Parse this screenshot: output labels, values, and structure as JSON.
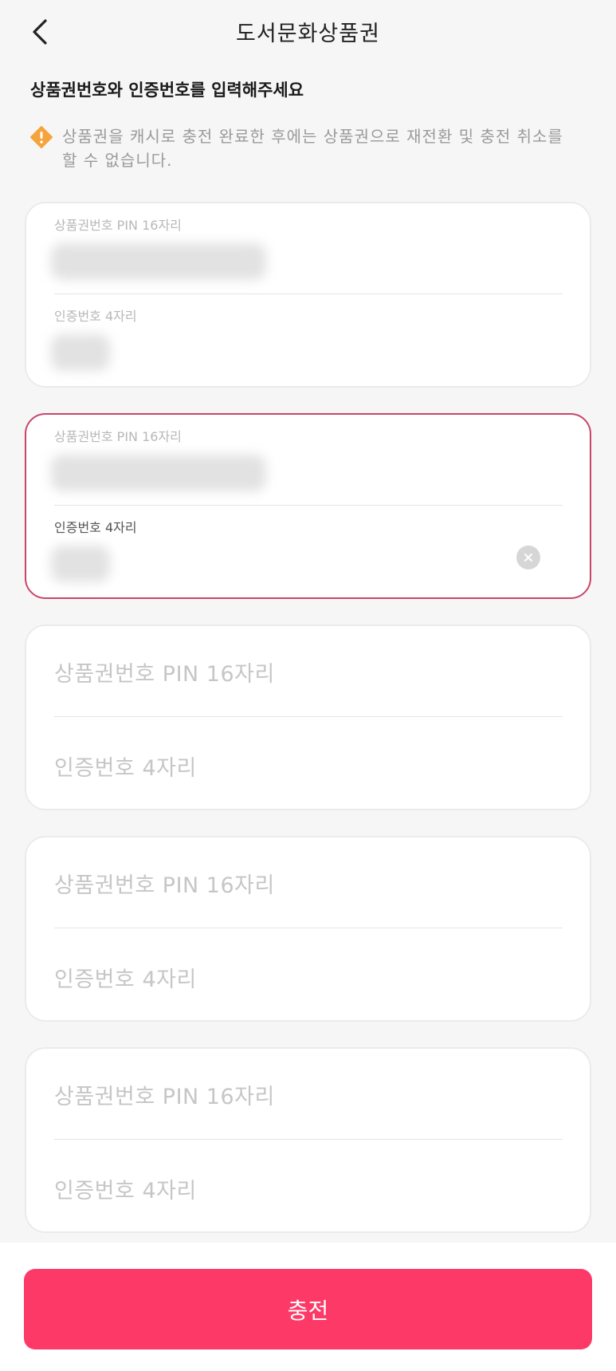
{
  "header": {
    "title": "도서문화상품권",
    "back_icon": "chevron-left-icon"
  },
  "instruction": "상품권번호와 인증번호를 입력해주세요",
  "notice": {
    "icon": "warning-icon",
    "icon_color": "#f5a33b",
    "line1": "상품권을 캐시로 충전 완료한 후에는 상품권으로 재전환 및 충전 취소를",
    "line2": "할 수 없습니다."
  },
  "cards": [
    {
      "pin_label": "상품권번호 PIN 16자리",
      "auth_label": "인증번호 4자리",
      "state": "filled"
    },
    {
      "pin_label": "상품권번호 PIN 16자리",
      "auth_label": "인증번호 4자리",
      "state": "focused"
    },
    {
      "pin_placeholder": "상품권번호 PIN 16자리",
      "auth_placeholder": "인증번호 4자리",
      "state": "empty"
    },
    {
      "pin_placeholder": "상품권번호 PIN 16자리",
      "auth_placeholder": "인증번호 4자리",
      "state": "empty"
    },
    {
      "pin_placeholder": "상품권번호 PIN 16자리",
      "auth_placeholder": "인증번호 4자리",
      "state": "empty"
    }
  ],
  "clear_icon": "clear-icon",
  "accent_color": "#fc3967",
  "focus_color": "#c9456a",
  "charge_button": "충전"
}
